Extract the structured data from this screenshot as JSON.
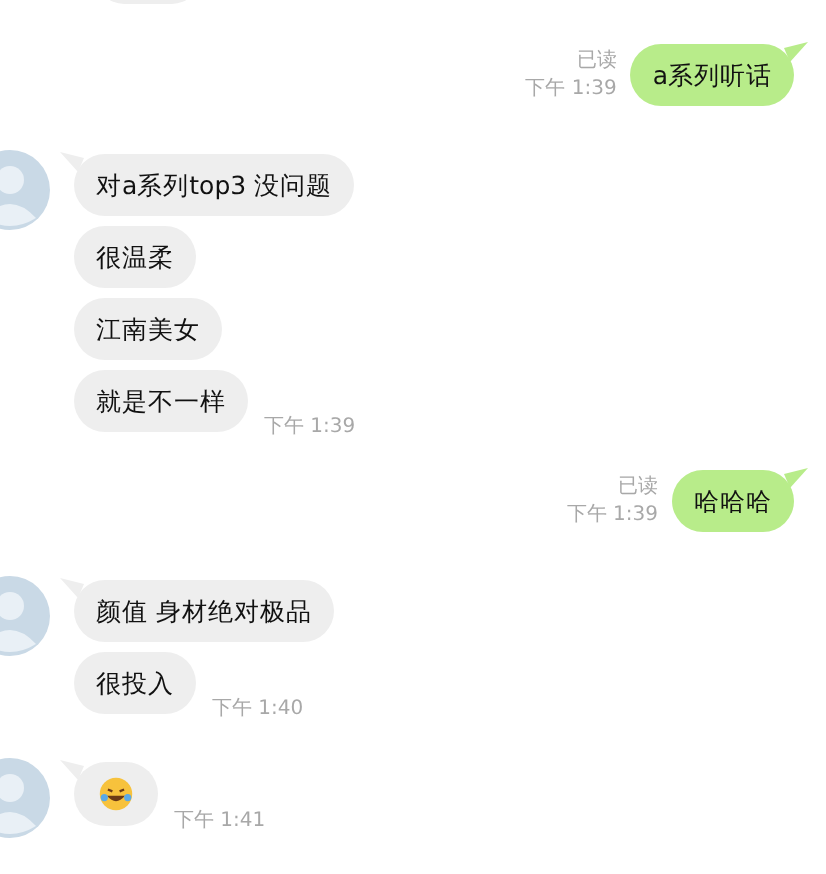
{
  "messages": [
    {
      "kind": "sent",
      "read_label": "已读",
      "time": "下午 1:39",
      "bubbles": [
        {
          "kind": "text",
          "text": "a系列听话"
        }
      ]
    },
    {
      "kind": "received",
      "time": "下午 1:39",
      "bubbles": [
        {
          "kind": "text",
          "text": "对a系列top3 没问题"
        },
        {
          "kind": "text",
          "text": "很温柔"
        },
        {
          "kind": "text",
          "text": "江南美女"
        },
        {
          "kind": "text",
          "text": "就是不一样"
        }
      ]
    },
    {
      "kind": "sent",
      "read_label": "已读",
      "time": "下午 1:39",
      "bubbles": [
        {
          "kind": "text",
          "text": "哈哈哈"
        }
      ]
    },
    {
      "kind": "received",
      "time": "下午 1:40",
      "bubbles": [
        {
          "kind": "text",
          "text": "颜值 身材绝对极品"
        },
        {
          "kind": "text",
          "text": "很投入"
        }
      ]
    },
    {
      "kind": "received",
      "time": "下午 1:41",
      "bubbles": [
        {
          "kind": "emoji"
        }
      ]
    }
  ]
}
